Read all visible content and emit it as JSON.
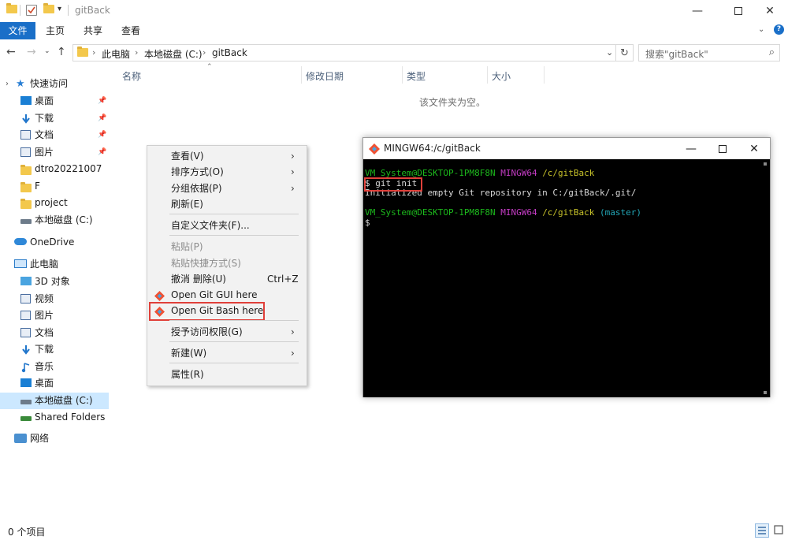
{
  "window": {
    "title": "gitBack"
  },
  "ribbon": {
    "tabs": [
      "文件",
      "主页",
      "共享",
      "查看"
    ]
  },
  "address": {
    "crumbs": [
      "此电脑",
      "本地磁盘 (C:)",
      "gitBack"
    ]
  },
  "search": {
    "placeholder": "搜索\"gitBack\""
  },
  "nav": {
    "quick_access": "快速访问",
    "quick_items": [
      {
        "label": "桌面",
        "icon": "desktop-icon",
        "color": "#1a7fd4"
      },
      {
        "label": "下载",
        "icon": "download-icon",
        "color": "#2277cc"
      },
      {
        "label": "文档",
        "icon": "document-icon",
        "color": "#4a6ea0"
      },
      {
        "label": "图片",
        "icon": "picture-icon",
        "color": "#4a6ea0"
      },
      {
        "label": "dtro20221007",
        "icon": "folder-icon",
        "color": "#f3c84c"
      },
      {
        "label": "F",
        "icon": "folder-icon",
        "color": "#f3c84c"
      },
      {
        "label": "project",
        "icon": "folder-icon",
        "color": "#f3c84c"
      },
      {
        "label": "本地磁盘 (C:)",
        "icon": "drive-icon",
        "color": "#6d7b8a"
      }
    ],
    "onedrive": "OneDrive",
    "this_pc": "此电脑",
    "pc_items": [
      {
        "label": "3D 对象",
        "icon": "3d-objects-icon",
        "color": "#4aa4e0"
      },
      {
        "label": "视频",
        "icon": "video-icon",
        "color": "#4a6ea0"
      },
      {
        "label": "图片",
        "icon": "picture-icon",
        "color": "#4a6ea0"
      },
      {
        "label": "文档",
        "icon": "document-icon",
        "color": "#4a6ea0"
      },
      {
        "label": "下载",
        "icon": "download-icon",
        "color": "#2277cc"
      },
      {
        "label": "音乐",
        "icon": "music-icon",
        "color": "#2277cc"
      },
      {
        "label": "桌面",
        "icon": "desktop-icon",
        "color": "#1a7fd4"
      },
      {
        "label": "本地磁盘 (C:)",
        "icon": "drive-icon",
        "color": "#6d7b8a"
      },
      {
        "label": "Shared Folders (\\\\",
        "icon": "network-drive-icon",
        "color": "#3a8a3a"
      }
    ],
    "network": "网络"
  },
  "columns": [
    "名称",
    "修改日期",
    "类型",
    "大小"
  ],
  "empty_message": "该文件夹为空。",
  "status": {
    "count": "0 个项目"
  },
  "context_menu": {
    "items": [
      {
        "label": "查看(V)",
        "arrow": true
      },
      {
        "label": "排序方式(O)",
        "arrow": true
      },
      {
        "label": "分组依据(P)",
        "arrow": true
      },
      {
        "label": "刷新(E)"
      },
      {
        "label": "自定义文件夹(F)..."
      },
      {
        "label": "粘贴(P)",
        "disabled": true
      },
      {
        "label": "粘贴快捷方式(S)",
        "disabled": true
      },
      {
        "label": "撤消 删除(U)",
        "shortcut": "Ctrl+Z"
      },
      {
        "label": "Open Git GUI here",
        "git": true
      },
      {
        "label": "Open Git Bash here",
        "git": true
      },
      {
        "label": "授予访问权限(G)",
        "arrow": true
      },
      {
        "label": "新建(W)",
        "arrow": true
      },
      {
        "label": "属性(R)"
      }
    ]
  },
  "terminal": {
    "title": "MINGW64:/c/gitBack",
    "prompt_user": "VM_System@DESKTOP-1PM8F8N",
    "prompt_sys": "MINGW64",
    "prompt_path": "/c/gitBack",
    "branch": "(master)",
    "cmd1": "$ git init",
    "output1": "Initialized empty Git repository in C:/gitBack/.git/",
    "cmd2": "$"
  },
  "colors": {
    "accent": "#1a6fc8",
    "highlight": "#e0403a",
    "selected": "#cce8ff"
  }
}
